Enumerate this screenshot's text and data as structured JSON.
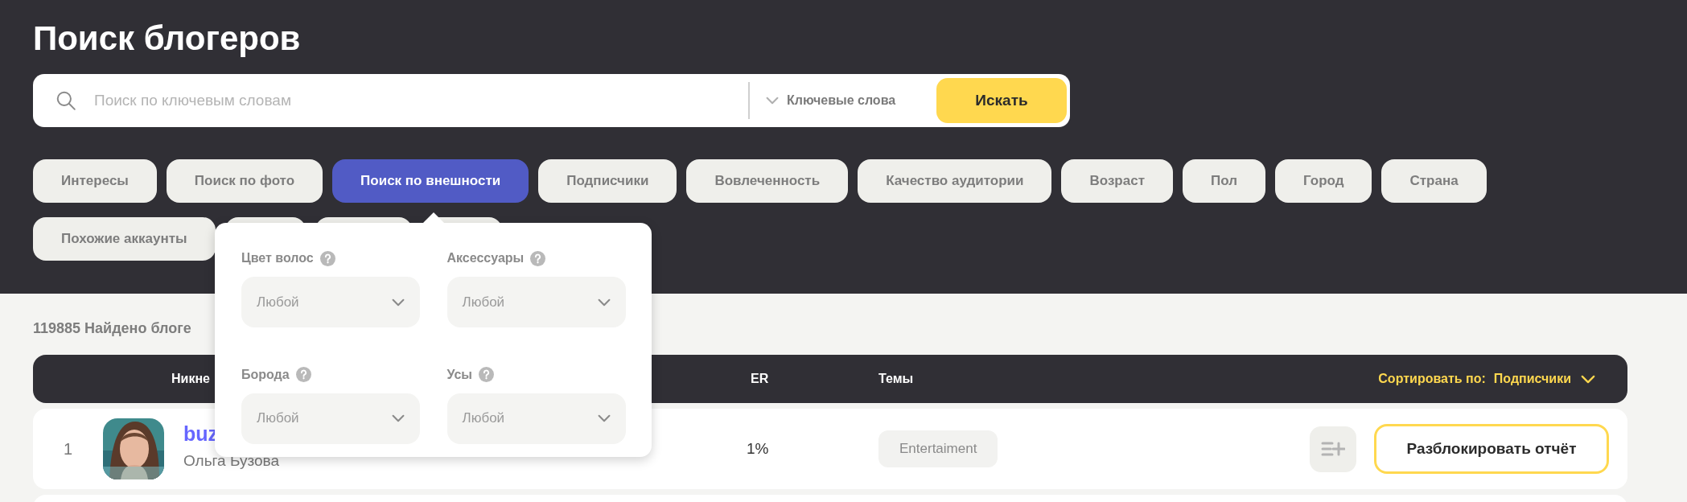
{
  "title": "Поиск блогеров",
  "search": {
    "placeholder": "Поиск по ключевым словам",
    "mode": "Ключевые слова",
    "button": "Искать"
  },
  "filters": [
    {
      "label": "Интересы",
      "selected": false
    },
    {
      "label": "Поиск по фото",
      "selected": false
    },
    {
      "label": "Поиск по внешности",
      "selected": true
    },
    {
      "label": "Подписчики",
      "selected": false
    },
    {
      "label": "Вовлеченность",
      "selected": false
    },
    {
      "label": "Качество аудитории",
      "selected": false
    },
    {
      "label": "Возраст",
      "selected": false
    },
    {
      "label": "Пол",
      "selected": false
    },
    {
      "label": "Город",
      "selected": false
    },
    {
      "label": "Страна",
      "selected": false
    },
    {
      "label": "Похожие аккаунты",
      "selected": false
    }
  ],
  "popup": {
    "fields": [
      {
        "label": "Цвет волос",
        "value": "Любой"
      },
      {
        "label": "Аксессуары",
        "value": "Любой"
      },
      {
        "label": "Борода",
        "value": "Любой"
      },
      {
        "label": "Усы",
        "value": "Любой"
      }
    ]
  },
  "results": {
    "count_text": "119885 Найдено блоге"
  },
  "table": {
    "columns": [
      "Никне",
      "ER",
      "Темы"
    ],
    "sort": {
      "label": "Сортировать по:",
      "value": "Подписчики"
    },
    "rows": [
      {
        "rank": "1",
        "nickname": "buz",
        "name": "Ольга Бузова",
        "er": "1%",
        "topic": "Entertaiment",
        "action": "Разблокировать отчёт"
      }
    ]
  }
}
